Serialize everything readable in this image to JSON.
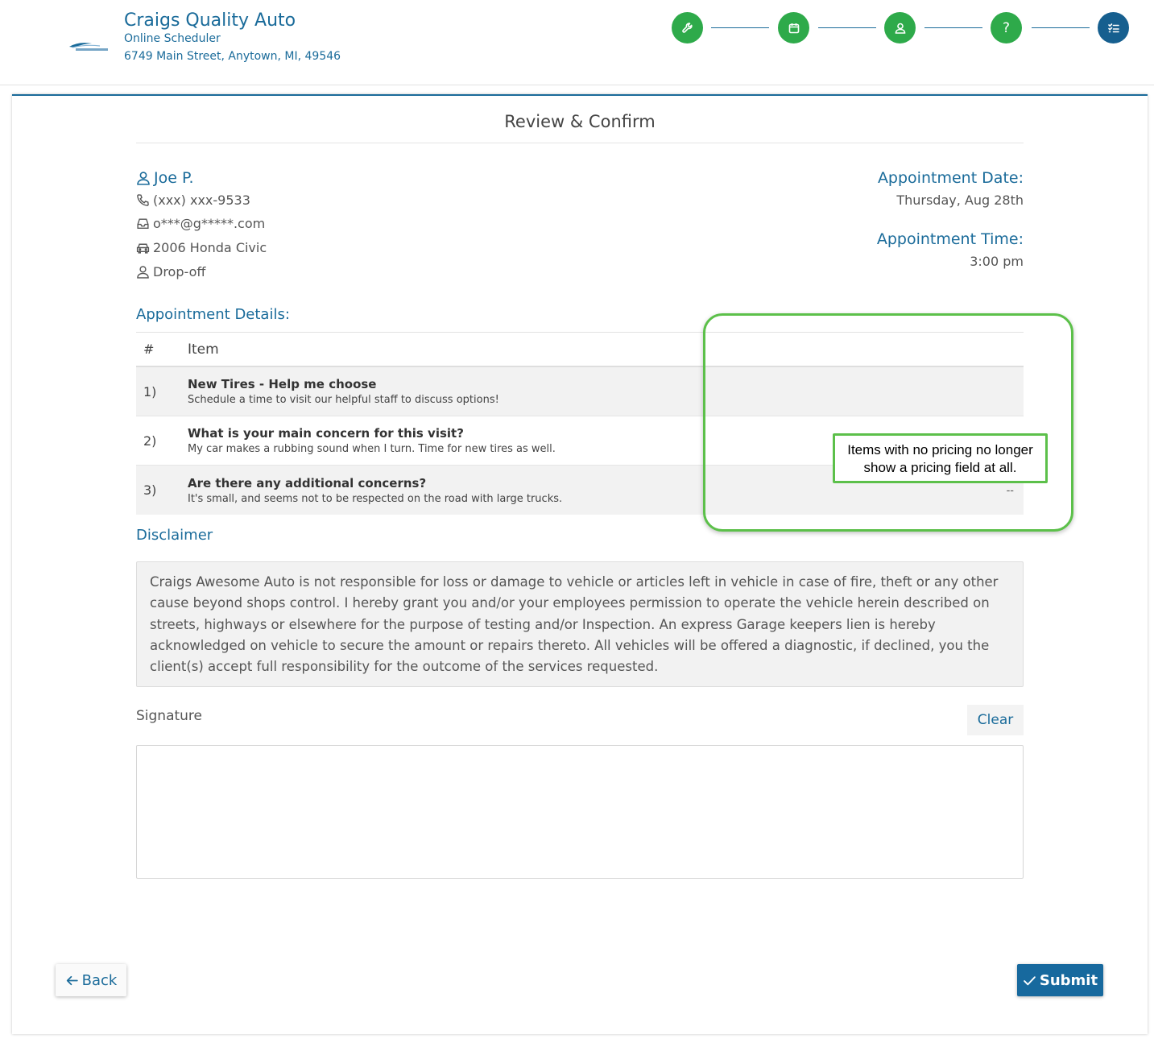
{
  "business": {
    "name": "Craigs Quality Auto",
    "subtitle": "Online Scheduler",
    "address": "6749 Main Street, Anytown, MI, 49546",
    "logo_icon": "awesome-auto-logo"
  },
  "steps": [
    {
      "icon": "wrench-icon",
      "status": "complete"
    },
    {
      "icon": "calendar-icon",
      "status": "complete"
    },
    {
      "icon": "user-icon",
      "status": "complete"
    },
    {
      "icon": "question-icon",
      "status": "complete",
      "glyph": "?"
    },
    {
      "icon": "checklist-icon",
      "status": "current"
    }
  ],
  "page": {
    "title": "Review & Confirm"
  },
  "customer": {
    "name": "Joe P.",
    "phone": "(xxx) xxx-9533",
    "email": "o***@g*****.com",
    "vehicle": "2006 Honda Civic",
    "service_type": "Drop-off"
  },
  "appointment": {
    "date_label": "Appointment Date:",
    "date": "Thursday, Aug 28th",
    "time_label": "Appointment Time:",
    "time": "3:00 pm"
  },
  "details": {
    "heading": "Appointment Details:",
    "col_num": "#",
    "col_item": "Item",
    "rows": [
      {
        "num": "1)",
        "title": "New Tires - Help me choose",
        "desc": "Schedule a time to visit our helpful staff to discuss options!",
        "price": ""
      },
      {
        "num": "2)",
        "title": "What is your main concern for this visit?",
        "desc": "My car makes a rubbing sound when I turn. Time for new tires as well.",
        "price": ""
      },
      {
        "num": "3)",
        "title": "Are there any additional concerns?",
        "desc": "It's small, and seems not to be respected on the road with large trucks.",
        "price": "--"
      }
    ]
  },
  "disclaimer": {
    "heading": "Disclaimer",
    "text": "Craigs Awesome Auto is not responsible for loss or damage to vehicle or articles left in vehicle in case of fire, theft or any other cause beyond shops control. I hereby grant you and/or your employees permission to operate the vehicle herein described on streets, highways or elsewhere for the purpose of testing and/or Inspection. An express Garage keepers lien is hereby acknowledged on vehicle to secure the amount or repairs thereto. All vehicles will be offered a diagnostic, if declined, you the client(s) accept full responsibility for the outcome of the services requested."
  },
  "signature": {
    "label": "Signature",
    "clear_label": "Clear"
  },
  "nav": {
    "back_label": "Back",
    "submit_label": "Submit"
  },
  "annotation": {
    "note": "Items with no pricing no longer show a pricing field at all.",
    "color": "#5cc04a"
  },
  "colors": {
    "brand_blue": "#1a6b9a",
    "step_complete": "#2eaa4a",
    "step_current": "#165f8f"
  }
}
